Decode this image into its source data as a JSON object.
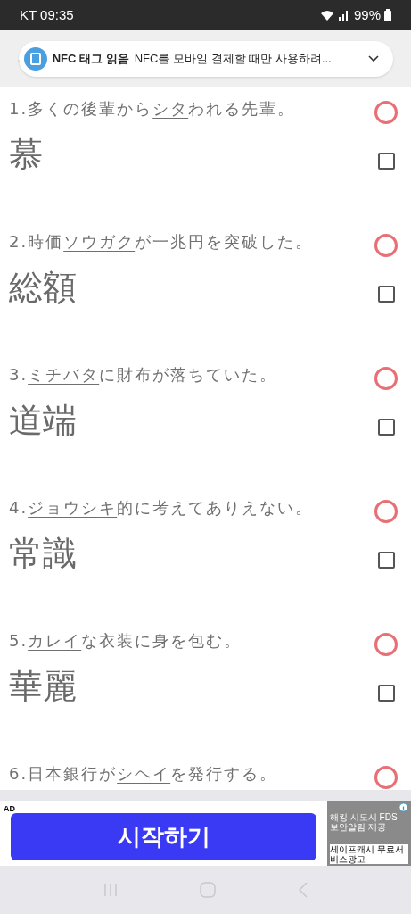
{
  "status_bar": {
    "carrier_time": "KT 09:35",
    "battery": "99%"
  },
  "toast": {
    "title": "NFC 태그 읽음",
    "message": "NFC를 모바일 결제할 때만 사용하려..."
  },
  "questions": [
    {
      "number": "1.",
      "before": "多くの後輩から",
      "target": "シタ",
      "after": "われる先輩。",
      "answer": "慕",
      "checked": false
    },
    {
      "number": "2.",
      "before": "時価",
      "target": "ソウガク",
      "after": "が一兆円を突破した。",
      "answer": "総額",
      "checked": false
    },
    {
      "number": "3.",
      "target": "ミチバタ",
      "after": "に財布が落ちていた。",
      "answer": "道端",
      "checked": false
    },
    {
      "number": "4.",
      "target": "ジョウシキ",
      "after": "的に考えてありえない。",
      "answer": "常識",
      "checked": false
    },
    {
      "number": "5.",
      "target": "カレイ",
      "after": "な衣装に身を包む。",
      "answer": "華麗",
      "checked": false
    },
    {
      "number": "6.",
      "before": "日本銀行が",
      "target": "シヘイ",
      "after": "を発行する。"
    }
  ],
  "ad": {
    "label": "AD",
    "button": "시작하기",
    "side_text": "해킹 시도시 FDS 보안알림 제공",
    "side_footer": "세이프캐시 무료서비스광고"
  }
}
